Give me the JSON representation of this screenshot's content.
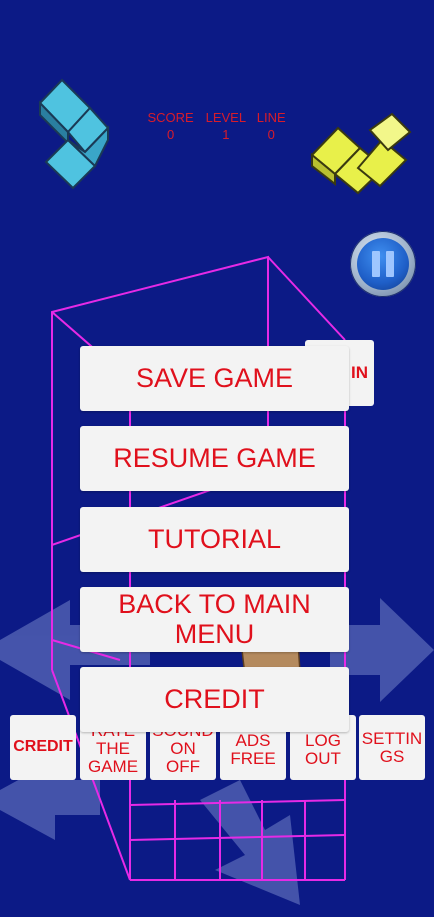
{
  "hud": {
    "score_label": "SCORE",
    "level_label": "LEVEL",
    "line_label": "LINE",
    "score": "0",
    "level": "1",
    "line": "0"
  },
  "pause": {
    "icon": "pause-icon"
  },
  "login_partial": "IN",
  "menu": {
    "save": "SAVE GAME",
    "resume": "RESUME GAME",
    "tutorial": "TUTORIAL",
    "back_line1": "BACK TO MAIN",
    "back_line2": "MENU",
    "credit": "CREDIT"
  },
  "bottom": {
    "credit": "CREDIT",
    "rate_line1": "RATE",
    "rate_line2": "THE",
    "rate_line3": "GAME",
    "sound_line1": "SOUND",
    "sound_line2": "ON",
    "sound_line3": "OFF",
    "ads_line1": "ADS",
    "ads_line2": "FREE",
    "logout_line1": "LOG",
    "logout_line2": "OUT",
    "settings_line1": "SETTIN",
    "settings_line2": "GS"
  },
  "colors": {
    "background": "#0c1a86",
    "text_red": "#e0101c",
    "grid_magenta": "#e62ae6",
    "block_cyan": "#4fc3e0",
    "block_yellow": "#e8f04a"
  }
}
